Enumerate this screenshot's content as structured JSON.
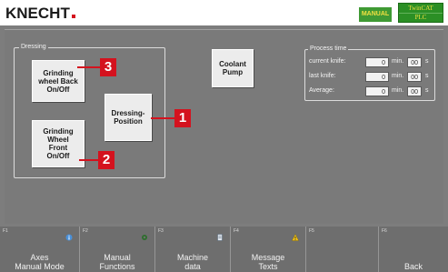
{
  "header": {
    "logo": "KNECHT",
    "mode": "MANUAL",
    "plc_line1": "TwinCAT",
    "plc_line2": "PLC"
  },
  "dressing": {
    "title": "Dressing",
    "grinding_back": "Grinding\nwheel Back\nOn/Off",
    "grinding_front": "Grinding\nWheel\nFront\nOn/Off",
    "dressing_position": "Dressing-\nPosition"
  },
  "coolant_pump": "Coolant\nPump",
  "process_time": {
    "title": "Process time",
    "rows": [
      {
        "label": "current knife:",
        "min": "0",
        "min_unit": "min.",
        "sec": "00",
        "sec_unit": "s"
      },
      {
        "label": "last knife:",
        "min": "0",
        "min_unit": "min.",
        "sec": "00",
        "sec_unit": "s"
      },
      {
        "label": "Average:",
        "min": "0",
        "min_unit": "min.",
        "sec": "00",
        "sec_unit": "s"
      }
    ]
  },
  "callouts": [
    "1",
    "2",
    "3"
  ],
  "function_keys": [
    {
      "num": "F1",
      "label": "Axes\nManual Mode",
      "icon": "info-icon"
    },
    {
      "num": "F2",
      "label": "Manual\nFunctions",
      "icon": "gear-icon"
    },
    {
      "num": "F3",
      "label": "Machine\ndata",
      "icon": "document-icon"
    },
    {
      "num": "F4",
      "label": "Message\nTexts",
      "icon": "warning-icon"
    },
    {
      "num": "F5",
      "label": "",
      "icon": ""
    },
    {
      "num": "F6",
      "label": "Back",
      "icon": ""
    }
  ],
  "colors": {
    "accent_red": "#d4121e",
    "plc_green": "#2b8f25",
    "panel_gray": "#7a7a7a"
  }
}
